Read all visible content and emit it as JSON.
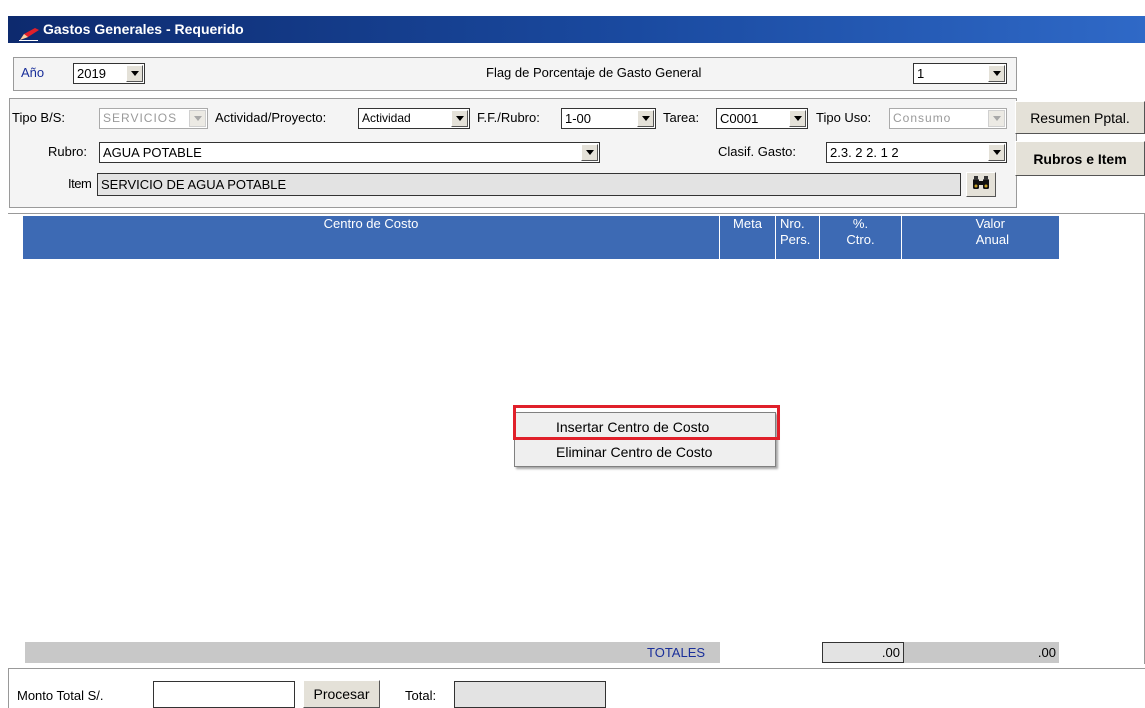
{
  "window": {
    "title": "Gastos Generales - Requerido",
    "icon": "pencil-icon"
  },
  "top": {
    "anio_label": "Año",
    "anio_value": "2019",
    "flag_label": "Flag de Porcentaje de Gasto General",
    "flag_value": "1"
  },
  "filters": {
    "tipo_bs_label": "Tipo B/S:",
    "tipo_bs_value": "SERVICIOS",
    "actividad_label": "Actividad/Proyecto:",
    "actividad_value": "Actividad",
    "ff_rubro_label": "F.F./Rubro:",
    "ff_rubro_value": "1-00",
    "tarea_label": "Tarea:",
    "tarea_value": "C0001",
    "tipo_uso_label": "Tipo Uso:",
    "tipo_uso_value": "Consumo",
    "rubro_label": "Rubro:",
    "rubro_value": "AGUA POTABLE",
    "clasif_label": "Clasif. Gasto:",
    "clasif_value": "2.3. 2  2. 1  2",
    "item_label": "Item",
    "item_value": "SERVICIO DE AGUA POTABLE",
    "search_icon": "binoculars-icon"
  },
  "side_buttons": {
    "resumen": "Resumen Pptal.",
    "rubros": "Rubros e Item"
  },
  "grid": {
    "columns": [
      {
        "line1": "Centro de Costo",
        "line2": ""
      },
      {
        "line1": "Meta",
        "line2": ""
      },
      {
        "line1": "Nro.",
        "line2": "Pers."
      },
      {
        "line1": "%.",
        "line2": "Ctro."
      },
      {
        "line1": "Valor",
        "line2": "Anual"
      }
    ],
    "totals_label": "TOTALES",
    "total_ctro": ".00",
    "total_anual": ".00"
  },
  "context_menu": {
    "items": [
      "Insertar Centro de Costo",
      "Eliminar Centro de Costo"
    ],
    "highlight_color": "#e0202a"
  },
  "footer": {
    "monto_label": "Monto Total S/.",
    "monto_value": "",
    "procesar_label": "Procesar",
    "total_label": "Total:",
    "total_value": ""
  },
  "colors": {
    "titlebar": "#1a4aa0",
    "grid_header": "#3d6ab4",
    "totals_text": "#1a2f9a"
  }
}
